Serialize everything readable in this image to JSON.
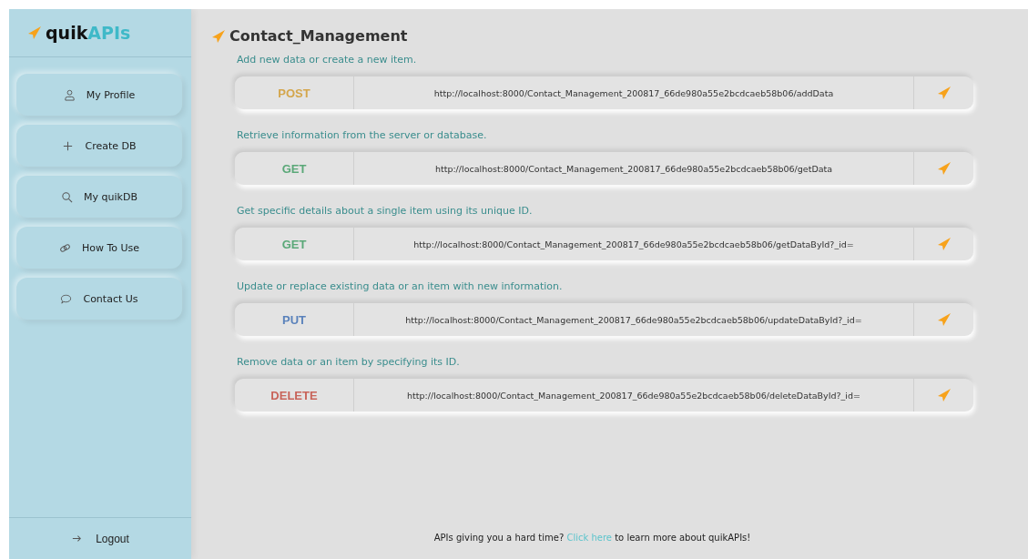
{
  "logo": {
    "prefix": "quik",
    "suffix": "APIs"
  },
  "sidebar": {
    "items": [
      {
        "label": "My Profile",
        "kind": "person"
      },
      {
        "label": "Create DB",
        "kind": "plus"
      },
      {
        "label": "My quikDB",
        "kind": "search"
      },
      {
        "label": "How To Use",
        "kind": "link"
      },
      {
        "label": "Contact Us",
        "kind": "chat"
      }
    ],
    "logout": "Logout"
  },
  "page_title": "Contact_Management",
  "endpoints": [
    {
      "description": "Add new data or create a new item.",
      "method": "POST",
      "color": "#d4a64c",
      "url": "http://localhost:8000/Contact_Management_200817_66de980a55e2bcdcaeb58b06/addData"
    },
    {
      "description": "Retrieve information from the server or database.",
      "method": "GET",
      "color": "#5aa878",
      "url": "http://localhost:8000/Contact_Management_200817_66de980a55e2bcdcaeb58b06/getData"
    },
    {
      "description": "Get specific details about a single item using its unique ID.",
      "method": "GET",
      "color": "#5aa878",
      "url": "http://localhost:8000/Contact_Management_200817_66de980a55e2bcdcaeb58b06/getDataById?_id="
    },
    {
      "description": "Update or replace existing data or an item with new information.",
      "method": "PUT",
      "color": "#5a82bb",
      "url": "http://localhost:8000/Contact_Management_200817_66de980a55e2bcdcaeb58b06/updateDataById?_id="
    },
    {
      "description": "Remove data or an item by specifying its ID.",
      "method": "DELETE",
      "color": "#c8645a",
      "url": "http://localhost:8000/Contact_Management_200817_66de980a55e2bcdcaeb58b06/deleteDataById?_id="
    }
  ],
  "footer": {
    "before": "APIs giving you a hard time?",
    "link": "Click here",
    "after": "to learn more about quikAPIs!"
  }
}
